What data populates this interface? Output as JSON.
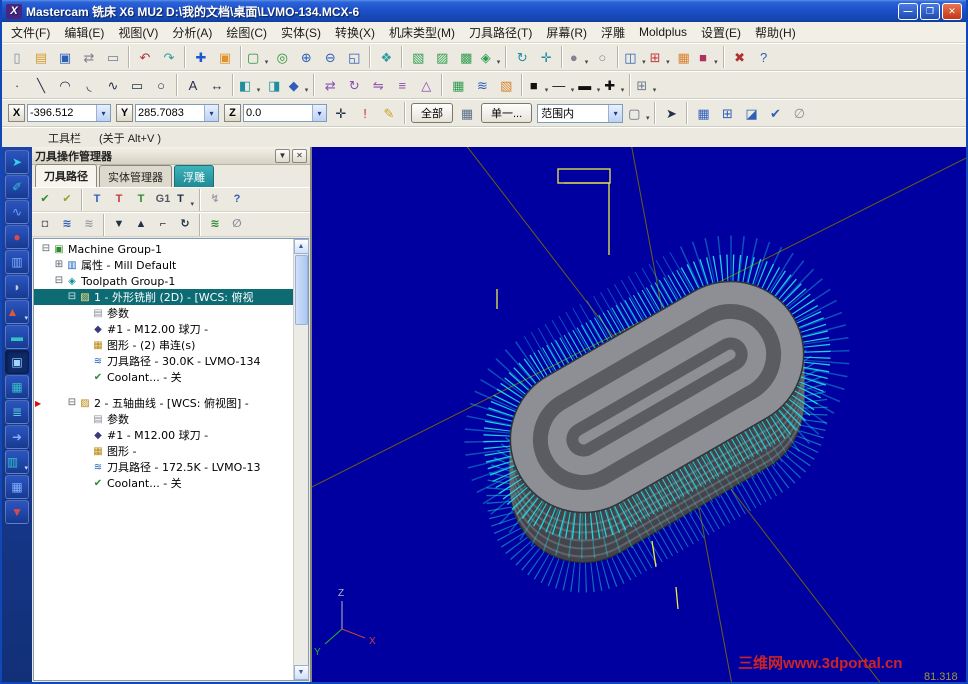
{
  "ui": {
    "dropdown": "▾",
    "menu_btn": "▼",
    "close_btn": "✕",
    "scroll_up": "▲",
    "scroll_down": "▼"
  },
  "window": {
    "logo": "X",
    "title": "Mastercam 铣床 X6 MU2  D:\\我的文档\\桌面\\LVMO-134.MCX-6",
    "min": "—",
    "max": "❐",
    "close": "✕"
  },
  "menu": {
    "items": [
      "文件(F)",
      "编辑(E)",
      "视图(V)",
      "分析(A)",
      "绘图(C)",
      "实体(S)",
      "转换(X)",
      "机床类型(M)",
      "刀具路径(T)",
      "屏幕(R)",
      "浮雕",
      "Moldplus",
      "设置(E)",
      "帮助(H)"
    ]
  },
  "toolbar1": {
    "icons": [
      {
        "name": "new-file-icon",
        "glyph": "▯",
        "color": "#7d8da0"
      },
      {
        "name": "open-file-icon",
        "glyph": "▤",
        "color": "#d89a2e"
      },
      {
        "name": "save-icon",
        "glyph": "▣",
        "color": "#2d5fb8"
      },
      {
        "name": "file-export-icon",
        "glyph": "⇄",
        "color": "#7a7f88"
      },
      {
        "name": "print-icon",
        "glyph": "▭",
        "color": "#6f7e90"
      },
      {
        "sep": true
      },
      {
        "name": "undo-icon",
        "glyph": "↶",
        "color": "#a83838"
      },
      {
        "name": "redo-icon",
        "glyph": "↷",
        "color": "#2e9aa0"
      },
      {
        "sep": true
      },
      {
        "name": "analyze-position-icon",
        "glyph": "✚",
        "color": "#1d56d2"
      },
      {
        "name": "analyze-dynamic-icon",
        "glyph": "▣",
        "color": "#e2912a"
      },
      {
        "sep": true
      },
      {
        "name": "zoom-window-icon",
        "glyph": "▢",
        "color": "#2d8f3a",
        "drop": true
      },
      {
        "name": "zoom-target-icon",
        "glyph": "◎",
        "color": "#2d8f3a"
      },
      {
        "name": "zoom-in-icon",
        "glyph": "⊕",
        "color": "#2d5fb8"
      },
      {
        "name": "zoom-out-icon",
        "glyph": "⊖",
        "color": "#2d5fb8"
      },
      {
        "name": "fit-screen-icon",
        "glyph": "◱",
        "color": "#2d5fb8"
      },
      {
        "sep": true
      },
      {
        "name": "repaint-icon",
        "glyph": "❖",
        "color": "#2e9aa0"
      },
      {
        "sep": true
      },
      {
        "name": "gview-top-icon",
        "glyph": "▧",
        "color": "#2f9e4f"
      },
      {
        "name": "gview-front-icon",
        "glyph": "▨",
        "color": "#2f9e4f"
      },
      {
        "name": "gview-side-icon",
        "glyph": "▩",
        "color": "#2f9e4f"
      },
      {
        "name": "gview-iso-icon",
        "glyph": "◈",
        "color": "#2f9e4f",
        "drop": true
      },
      {
        "sep": true
      },
      {
        "name": "rotate-view-icon",
        "glyph": "↻",
        "color": "#1f8fa0"
      },
      {
        "name": "pan-view-icon",
        "glyph": "✛",
        "color": "#1f8fa0"
      },
      {
        "sep": true
      },
      {
        "name": "shading-icon",
        "glyph": "●",
        "color": "#80868f",
        "drop": true
      },
      {
        "name": "wireframe-icon",
        "glyph": "○",
        "color": "#80868f"
      },
      {
        "sep": true
      },
      {
        "name": "planes-icon",
        "glyph": "◫",
        "color": "#2d5fb8",
        "drop": true
      },
      {
        "name": "levels-icon",
        "glyph": "⊞",
        "color": "#c03a3a",
        "drop": true
      },
      {
        "name": "attributes-icon",
        "glyph": "▦",
        "color": "#d8822e"
      },
      {
        "name": "set-color-icon",
        "glyph": "■",
        "color": "#b03060",
        "drop": true
      },
      {
        "sep": true
      },
      {
        "name": "delete-entity-icon",
        "glyph": "✖",
        "color": "#b03030"
      },
      {
        "name": "help-icon",
        "glyph": "?",
        "color": "#2d5fb8"
      }
    ]
  },
  "toolbar2": {
    "icons": [
      {
        "name": "create-point-icon",
        "glyph": "∙",
        "color": "#23304a"
      },
      {
        "name": "create-line-icon",
        "glyph": "╲",
        "color": "#23304a"
      },
      {
        "name": "create-arc-icon",
        "glyph": "◠",
        "color": "#23304a"
      },
      {
        "name": "create-fillet-icon",
        "glyph": "◟",
        "color": "#23304a"
      },
      {
        "name": "create-spline-icon",
        "glyph": "∿",
        "color": "#23304a"
      },
      {
        "name": "create-rectangle-icon",
        "glyph": "▭",
        "color": "#23304a"
      },
      {
        "name": "create-circle-icon",
        "glyph": "○",
        "color": "#23304a"
      },
      {
        "sep": true
      },
      {
        "name": "create-text-icon",
        "glyph": "A",
        "color": "#23304a"
      },
      {
        "name": "dimension-icon",
        "glyph": "↔",
        "color": "#23304a"
      },
      {
        "sep": true
      },
      {
        "name": "surface-create-icon",
        "glyph": "◧",
        "color": "#1f8fa0",
        "drop": true
      },
      {
        "name": "surface-trim-icon",
        "glyph": "◨",
        "color": "#1f8fa0"
      },
      {
        "name": "solid-extrude-icon",
        "glyph": "◆",
        "color": "#2d5fb8",
        "drop": true
      },
      {
        "sep": true
      },
      {
        "name": "xform-translate-icon",
        "glyph": "⇄",
        "color": "#8a4fb0"
      },
      {
        "name": "xform-rotate-icon",
        "glyph": "↻",
        "color": "#8a4fb0"
      },
      {
        "name": "xform-mirror-icon",
        "glyph": "⇋",
        "color": "#8a4fb0"
      },
      {
        "name": "xform-offset-icon",
        "glyph": "≡",
        "color": "#8a4fb0"
      },
      {
        "name": "xform-scale-icon",
        "glyph": "△",
        "color": "#8a4fb0"
      },
      {
        "sep": true
      },
      {
        "name": "machine-def-icon",
        "glyph": "▦",
        "color": "#2f9e4f"
      },
      {
        "name": "toolpath-ops-icon",
        "glyph": "≋",
        "color": "#2d5fb8"
      },
      {
        "name": "stock-setup-icon",
        "glyph": "▧",
        "color": "#d8822e"
      },
      {
        "sep": true
      },
      {
        "name": "attribute-color-icon",
        "glyph": "■",
        "color": "#101010",
        "drop": true
      },
      {
        "name": "line-style-icon",
        "glyph": "—",
        "color": "#101010",
        "drop": true
      },
      {
        "name": "line-width-icon",
        "glyph": "▬",
        "color": "#101010",
        "drop": true
      },
      {
        "name": "point-style-icon",
        "glyph": "✚",
        "color": "#101010",
        "drop": true
      },
      {
        "sep": true
      },
      {
        "name": "grid-settings-icon",
        "glyph": "⊞",
        "color": "#6f7e90",
        "drop": true
      }
    ]
  },
  "coordbar": {
    "x_label": "X",
    "x_value": "-396.512",
    "y_label": "Y",
    "y_value": "285.7083",
    "z_label": "Z",
    "z_value": "0.0",
    "all_button": "全部",
    "single_button": "单一...",
    "range_value": "范围内",
    "left_icons": [
      {
        "name": "fast-point-icon",
        "glyph": "✛",
        "color": "#23304a"
      },
      {
        "name": "construction-mode-icon",
        "glyph": "!",
        "color": "#c03a3a"
      },
      {
        "name": "sketch-edit-icon",
        "glyph": "✎",
        "color": "#c8a020"
      },
      {
        "sep": true
      }
    ],
    "mid_icons": [
      {
        "name": "select-last-icon",
        "glyph": "▦",
        "color": "#5a6d88"
      }
    ],
    "right_icons": [
      {
        "name": "select-window-icon",
        "glyph": "▢",
        "color": "#5a6d88",
        "drop": true
      },
      {
        "sep": true
      },
      {
        "name": "select-arrow-icon",
        "glyph": "➤",
        "color": "#23304a"
      },
      {
        "sep": true
      },
      {
        "name": "selection-grid-icon",
        "glyph": "▦",
        "color": "#2d5fb8"
      },
      {
        "name": "selection-add-icon",
        "glyph": "⊞",
        "color": "#2d5fb8"
      },
      {
        "name": "selection-solids-icon",
        "glyph": "◪",
        "color": "#2d5fb8"
      },
      {
        "name": "selection-validate-icon",
        "glyph": "✔",
        "color": "#2d5fb8"
      },
      {
        "name": "selection-clear-icon",
        "glyph": "∅",
        "color": "#8a9099"
      }
    ]
  },
  "hintbar": {
    "name": "工具栏",
    "hint": "(关于 Alt+V )"
  },
  "sidebar": {
    "icons": [
      {
        "name": "select-tool-icon",
        "glyph": "➤",
        "color": "#35d0e8"
      },
      {
        "name": "flag-tool-icon",
        "glyph": "✐",
        "color": "#35c0d8"
      },
      {
        "name": "curve-tool-icon",
        "glyph": "∿",
        "color": "#6fa0ff"
      },
      {
        "name": "sphere-tool-icon",
        "glyph": "●",
        "color": "#e04848"
      },
      {
        "name": "surface-panel-icon",
        "glyph": "▥",
        "color": "#7fb0ff"
      },
      {
        "name": "cylinder-tool-icon",
        "glyph": "◗",
        "color": "#c8ccd4"
      },
      {
        "name": "cone-tool-icon",
        "glyph": "▲",
        "color": "#e05838",
        "drop": true
      },
      {
        "name": "plane-tool-icon",
        "glyph": "▬",
        "color": "#35c0c8"
      },
      {
        "name": "operations-manager-icon",
        "glyph": "▣",
        "color": "#9fd8ff",
        "cls": "pressed"
      },
      {
        "name": "grid-manager-icon",
        "glyph": "▦",
        "color": "#35c0c8"
      },
      {
        "name": "book-manager-icon",
        "glyph": "≣",
        "color": "#58c8d8"
      },
      {
        "name": "arrow-blue-icon",
        "glyph": "➜",
        "color": "#7fb0ff"
      },
      {
        "name": "panel-manager-icon",
        "glyph": "▥",
        "color": "#35c0c8",
        "drop": true
      },
      {
        "name": "grid2-icon",
        "glyph": "▦",
        "color": "#7fb0ff"
      },
      {
        "name": "drop-tool-icon",
        "glyph": "▼",
        "color": "#e04848"
      }
    ]
  },
  "manager": {
    "title": "刀具操作管理器",
    "tabs": [
      "刀具路径",
      "实体管理器",
      "浮雕"
    ],
    "toolbar_row1": [
      {
        "name": "select-all-operations-icon",
        "glyph": "✔",
        "color": "#2e8b2e"
      },
      {
        "name": "select-all-dirty-operations-icon",
        "glyph": "✔",
        "color": "#9aa22e"
      },
      {
        "sep": true
      },
      {
        "name": "regen-selected-icon",
        "glyph": "T",
        "color": "#2d5fb8"
      },
      {
        "name": "regen-all-icon",
        "glyph": "T",
        "color": "#c03a3a"
      },
      {
        "name": "verify-icon",
        "glyph": "T",
        "color": "#2e8b2e"
      },
      {
        "name": "backplot-icon",
        "glyph": "G1",
        "color": "#555c66"
      },
      {
        "name": "post-icon",
        "glyph": "T",
        "color": "#23304a",
        "drop": true
      },
      {
        "sep": true
      },
      {
        "name": "highfeed-icon",
        "glyph": "↯",
        "color": "#9aa0a8"
      },
      {
        "name": "ops-help-icon",
        "glyph": "?",
        "color": "#2d5fb8"
      }
    ],
    "toolbar_row2": [
      {
        "name": "lock-toolpath-icon",
        "glyph": "◘",
        "color": "#6a7078"
      },
      {
        "name": "toggle-toolpath-display-icon",
        "glyph": "≋",
        "color": "#2d5fb8"
      },
      {
        "name": "toggle-rapid-display-icon",
        "glyph": "≋",
        "color": "#9aa0a8"
      },
      {
        "sep": true
      },
      {
        "name": "move-insert-down-icon",
        "glyph": "▼",
        "color": "#23304a"
      },
      {
        "name": "move-insert-up-icon",
        "glyph": "▲",
        "color": "#23304a"
      },
      {
        "name": "insert-arrow-icon",
        "glyph": "⌐",
        "color": "#23304a"
      },
      {
        "name": "scroll-insert-icon",
        "glyph": "↻",
        "color": "#23304a"
      },
      {
        "sep": true
      },
      {
        "name": "toolpath-trace-icon",
        "glyph": "≋",
        "color": "#2e8b2e"
      },
      {
        "name": "no-display-icon",
        "glyph": "∅",
        "color": "#8a9099"
      }
    ],
    "tree": [
      {
        "depth": 0,
        "expander": "⊟",
        "icon": "machine-group-icon",
        "glyph": "▣",
        "color": "#2e8b2e",
        "label": "Machine Group-1"
      },
      {
        "depth": 1,
        "expander": "⊞",
        "icon": "properties-icon",
        "glyph": "▥",
        "color": "#1f5fc0",
        "label": "属性 - Mill Default"
      },
      {
        "depth": 1,
        "expander": "⊟",
        "icon": "toolpath-group-icon",
        "glyph": "◈",
        "color": "#0e8a94",
        "label": "Toolpath Group-1"
      },
      {
        "depth": 2,
        "expander": "⊟",
        "icon": "operation-icon",
        "glyph": "▨",
        "color": "#ffe080",
        "label": "1 - 外形铣削 (2D) - [WCS: 俯视",
        "selected": true
      },
      {
        "depth": 3,
        "icon": "parameters-icon",
        "glyph": "▤",
        "color": "#8a8f98",
        "label": "参数"
      },
      {
        "depth": 3,
        "icon": "tool-icon",
        "glyph": "◆",
        "color": "#3a3a7a",
        "label": "#1 - M12.00 球刀 -"
      },
      {
        "depth": 3,
        "icon": "geometry-icon",
        "glyph": "▦",
        "color": "#b8860b",
        "label": "图形 - (2) 串连(s)"
      },
      {
        "depth": 3,
        "icon": "toolpath-file-icon",
        "glyph": "≋",
        "color": "#1f5fc0",
        "label": "刀具路径 - 30.0K - LVMO-134"
      },
      {
        "depth": 3,
        "icon": "coolant-icon",
        "glyph": "✔",
        "color": "#2e8b2e",
        "label": "Coolant... - 关"
      },
      {
        "spacer": true
      },
      {
        "depth": 2,
        "expander": "⊟",
        "marker": true,
        "icon": "operation-icon",
        "glyph": "▨",
        "color": "#b8860b",
        "label": "2 - 五轴曲线 - [WCS: 俯视图] -"
      },
      {
        "depth": 3,
        "icon": "parameters-icon",
        "glyph": "▤",
        "color": "#8a8f98",
        "label": "参数"
      },
      {
        "depth": 3,
        "icon": "tool-icon",
        "glyph": "◆",
        "color": "#3a3a7a",
        "label": "#1 - M12.00 球刀 -"
      },
      {
        "depth": 3,
        "icon": "geometry-icon",
        "glyph": "▦",
        "color": "#b8860b",
        "label": "图形 -"
      },
      {
        "depth": 3,
        "icon": "toolpath-file-icon",
        "glyph": "≋",
        "color": "#1f5fc0",
        "label": "刀具路径 - 172.5K - LVMO-13"
      },
      {
        "depth": 3,
        "icon": "coolant-icon",
        "glyph": "✔",
        "color": "#2e8b2e",
        "label": "Coolant... - 关"
      }
    ]
  },
  "viewport": {
    "watermark": "三维网www.3dportal.cn",
    "readout": "81.318",
    "axis_labels": {
      "x": "X",
      "y": "Y",
      "z": "Z"
    }
  }
}
